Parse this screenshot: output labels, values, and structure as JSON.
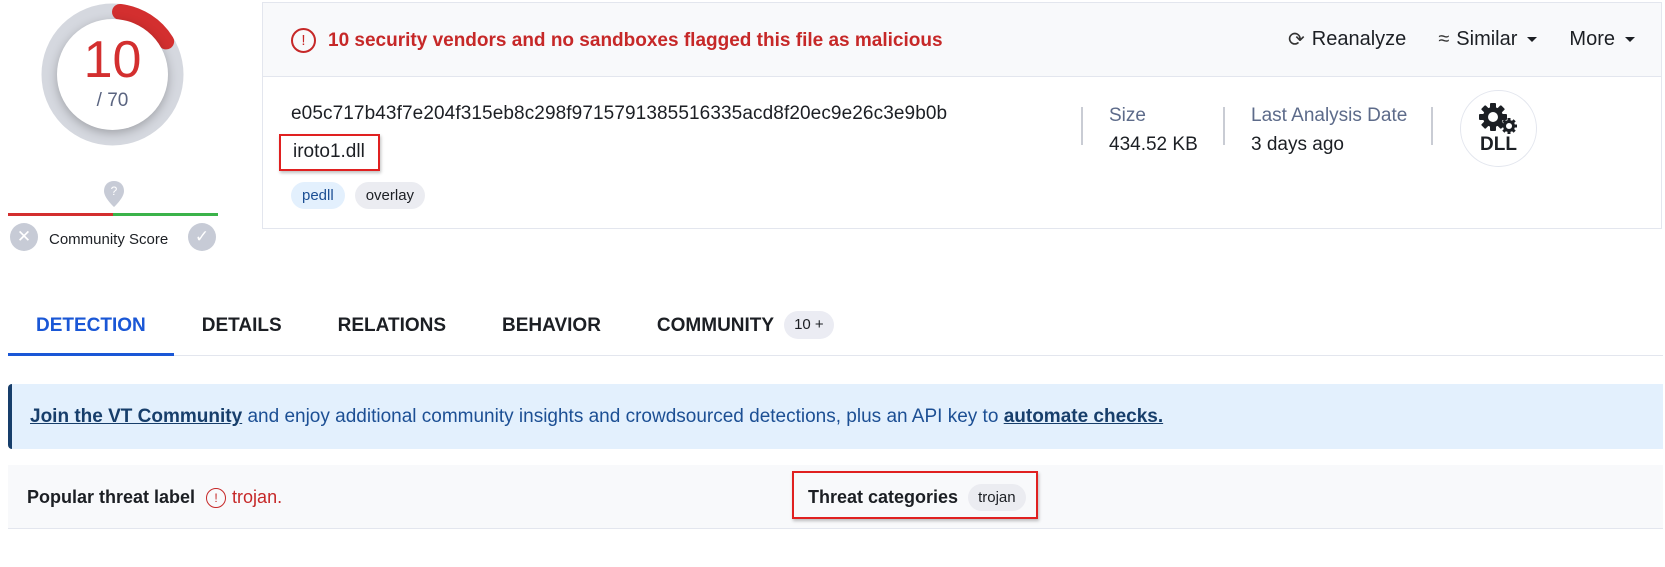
{
  "score": {
    "detections": "10",
    "total": "/ 70",
    "detection_ratio": 0.1429,
    "color": "#d32f2f"
  },
  "community": {
    "label": "Community Score",
    "marker_icon": "question-marker-icon",
    "down_icon": "x-icon",
    "up_icon": "check-icon"
  },
  "header": {
    "alert_icon": "exclamation-circle-icon",
    "alert_text": "10 security vendors and no sandboxes flagged this file as malicious",
    "actions": [
      {
        "label": "Reanalyze",
        "icon": "refresh-icon"
      },
      {
        "label": "Similar",
        "icon": "similar-icon",
        "dropdown": true
      },
      {
        "label": "More",
        "dropdown": true
      }
    ]
  },
  "file": {
    "hash": "e05c717b43f7e204f315eb8c298f9715791385516335acd8f20ec9e26c3e9b0b",
    "name": "iroto1.dll",
    "tags": [
      "pedll",
      "overlay"
    ],
    "size_label": "Size",
    "size_value": "434.52 KB",
    "date_label": "Last Analysis Date",
    "date_value": "3 days ago",
    "type_badge": "DLL"
  },
  "tabs": [
    {
      "label": "DETECTION",
      "active": true
    },
    {
      "label": "DETAILS"
    },
    {
      "label": "RELATIONS"
    },
    {
      "label": "BEHAVIOR"
    },
    {
      "label": "COMMUNITY",
      "count": "10 +"
    }
  ],
  "banner": {
    "link1": "Join the VT Community",
    "text": " and enjoy additional community insights and crowdsourced detections, plus an API key to ",
    "link2": "automate checks."
  },
  "threat": {
    "popular_label": "Popular threat label",
    "popular_value": "trojan.",
    "categories_label": "Threat categories",
    "categories": [
      "trojan"
    ]
  }
}
